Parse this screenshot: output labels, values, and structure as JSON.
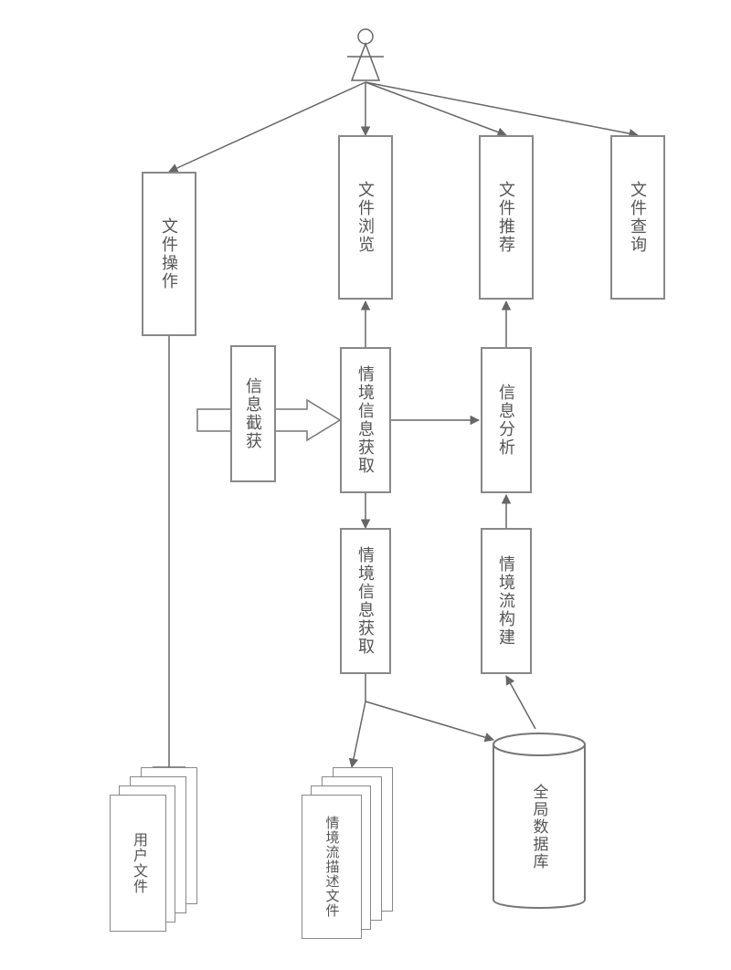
{
  "boxes": {
    "file_op": "文件操作",
    "file_browse": "文件浏览",
    "file_recommend": "文件推荐",
    "file_query": "文件查询",
    "info_intercept": "信息截获",
    "ctx_info_get_a": "情境信息获取",
    "ctx_info_get_b": "情境信息获取",
    "info_analysis": "信息分析",
    "ctx_flow_build": "情境流构建",
    "db_label": "全局数据库"
  },
  "stacks": {
    "user_files": "用户文件",
    "ctx_flow_def": "情境流描述文件"
  }
}
